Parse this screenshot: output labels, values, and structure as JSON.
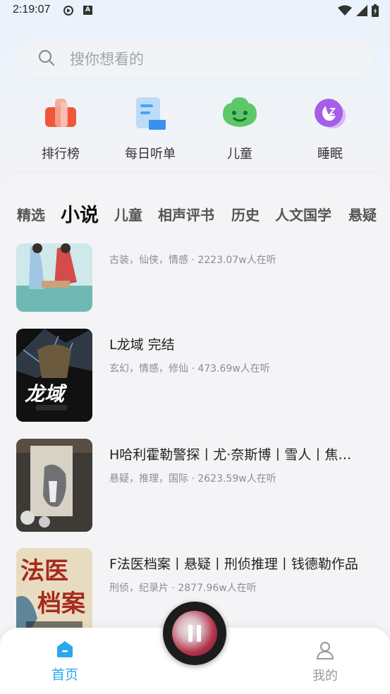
{
  "status_bar": {
    "time": "2:19:07"
  },
  "search": {
    "placeholder": "搜你想看的"
  },
  "quick_categories": [
    {
      "label": "排行榜",
      "icon": "ranking-icon"
    },
    {
      "label": "每日听单",
      "icon": "daily-list-icon"
    },
    {
      "label": "儿童",
      "icon": "kids-icon"
    },
    {
      "label": "睡眠",
      "icon": "sleep-icon"
    }
  ],
  "tabs": [
    "精选",
    "小说",
    "儿童",
    "相声评书",
    "历史",
    "人文国学",
    "悬疑"
  ],
  "active_tab": "小说",
  "books": [
    {
      "title": "",
      "meta": "古装，仙侠，情感 · 2223.07w人在听"
    },
    {
      "title": "L龙域  完结",
      "meta": "玄幻，情感，修仙 · 473.69w人在听"
    },
    {
      "title": "H哈利霍勒警探丨尤·奈斯博丨雪人丨焦渴丨知更鸟丨猎豹",
      "meta": "悬疑，推理，国际 · 2623.59w人在听"
    },
    {
      "title": "F法医档案丨悬疑丨刑侦推理丨钱德勒作品",
      "meta": "刑侦，纪录片 · 2877.96w人在听"
    }
  ],
  "bottom_nav": {
    "home": "首页",
    "mine": "我的"
  },
  "colors": {
    "accent": "#2aa8ee",
    "text_primary": "#222222",
    "text_secondary": "#8a8d92"
  }
}
